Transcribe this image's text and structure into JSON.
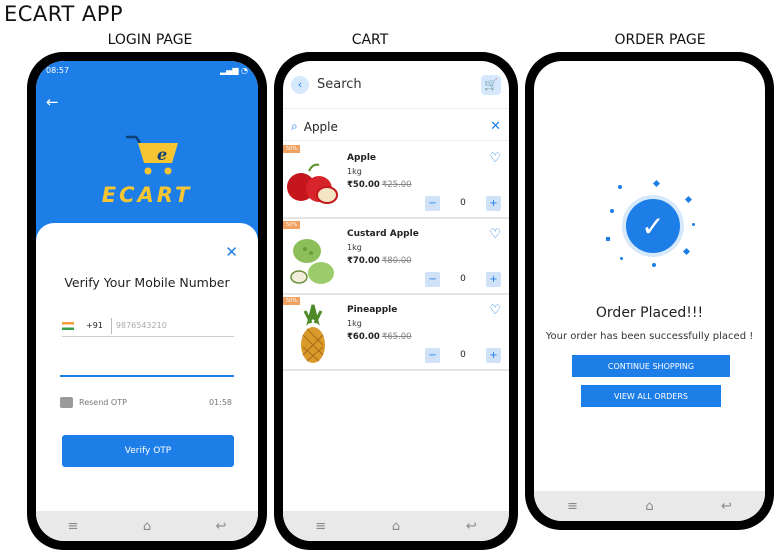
{
  "app_title": "ECART APP",
  "labels": {
    "login": "LOGIN PAGE",
    "cart": "CART",
    "order": "ORDER  PAGE"
  },
  "login": {
    "status_time": "08:57",
    "logo_text": "ECART",
    "title": "Verify Your Mobile Number",
    "country_code": "+91",
    "phone_placeholder": "9876543210",
    "resend_label": "Resend OTP",
    "timer": "01:58",
    "verify_button": "Verify OTP"
  },
  "cart": {
    "header_title": "Search",
    "search_value": "Apple",
    "products": [
      {
        "name": "Apple",
        "qty": "1kg",
        "price": "₹50.00",
        "old_price": "₹25.00",
        "count": "0",
        "badge": "50%"
      },
      {
        "name": "Custard Apple",
        "qty": "1kg",
        "price": "₹70.00",
        "old_price": "₹80.00",
        "count": "0",
        "badge": "50%"
      },
      {
        "name": "Pineapple",
        "qty": "1kg",
        "price": "₹60.00",
        "old_price": "₹65.00",
        "count": "0",
        "badge": "50%"
      }
    ]
  },
  "order": {
    "title": "Order Placed!!!",
    "subtitle": "Your order has been successfully placed !",
    "continue_button": "CONTINUE SHOPPING",
    "view_orders_button": "VIEW ALL ORDERS"
  },
  "colors": {
    "primary": "#1e7ee8",
    "logo_yellow": "#f6c632"
  }
}
